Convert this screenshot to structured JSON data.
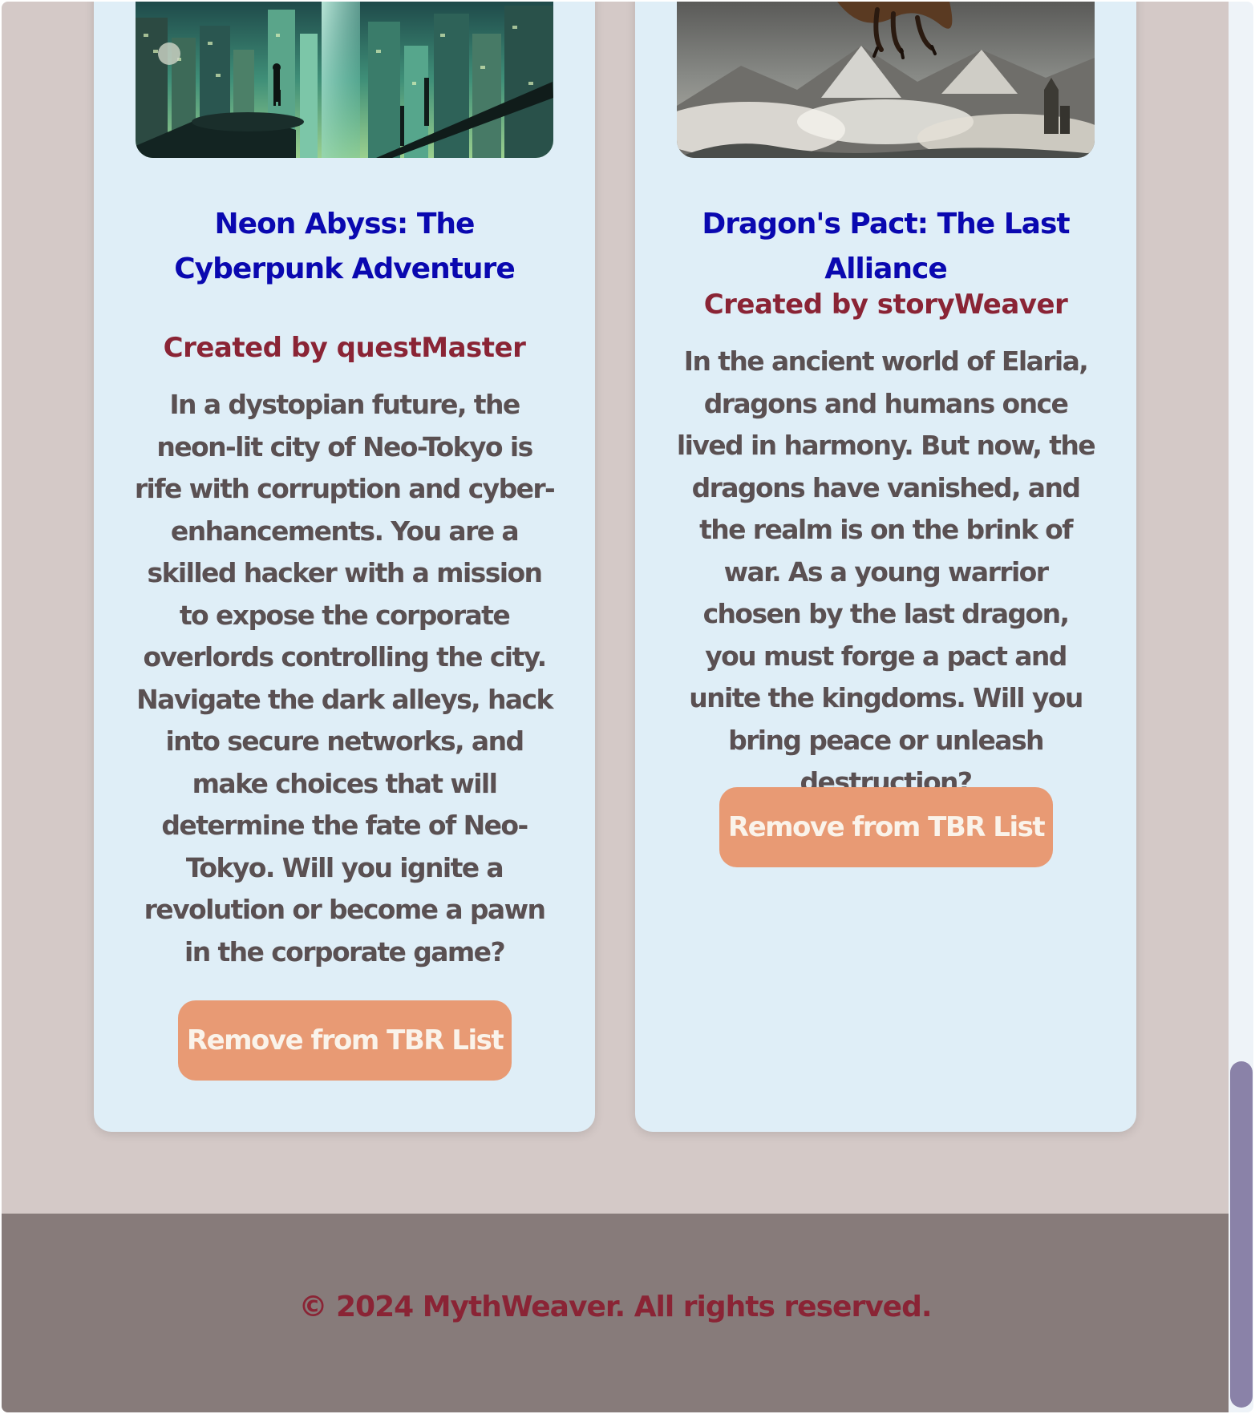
{
  "cards": [
    {
      "title": "Neon Abyss: The Cyberpunk Adventure",
      "author": "Created by questMaster",
      "description": "In a dystopian future, the neon-lit city of Neo-Tokyo is rife with corruption and cyber-enhancements. You are a skilled hacker with a mission to expose the corporate overlords controlling the city. Navigate the dark alleys, hack into secure networks, and make choices that will determine the fate of Neo-Tokyo. Will you ignite a revolution or become a pawn in the corporate game?",
      "button_label": "Remove from TBR List"
    },
    {
      "title": "Dragon's Pact: The Last Alliance",
      "author": "Created by storyWeaver",
      "description": "In the ancient world of Elaria, dragons and humans once lived in harmony. But now, the dragons have vanished, and the realm is on the brink of war. As a young warrior chosen by the last dragon, you must forge a pact and unite the kingdoms. Will you bring peace or unleash destruction?",
      "button_label": "Remove from TBR List"
    }
  ],
  "footer": {
    "text": "© 2024 MythWeaver. All rights reserved."
  },
  "colors": {
    "page_background": "#d4c9c7",
    "card_background": "#dfeef7",
    "title": "#0a08b0",
    "author": "#8a2435",
    "description": "#5a5052",
    "button": "#e89a74",
    "button_text": "#faf3ea",
    "footer_background": "#877b7a",
    "scrollbar_thumb": "#8a82a8"
  }
}
